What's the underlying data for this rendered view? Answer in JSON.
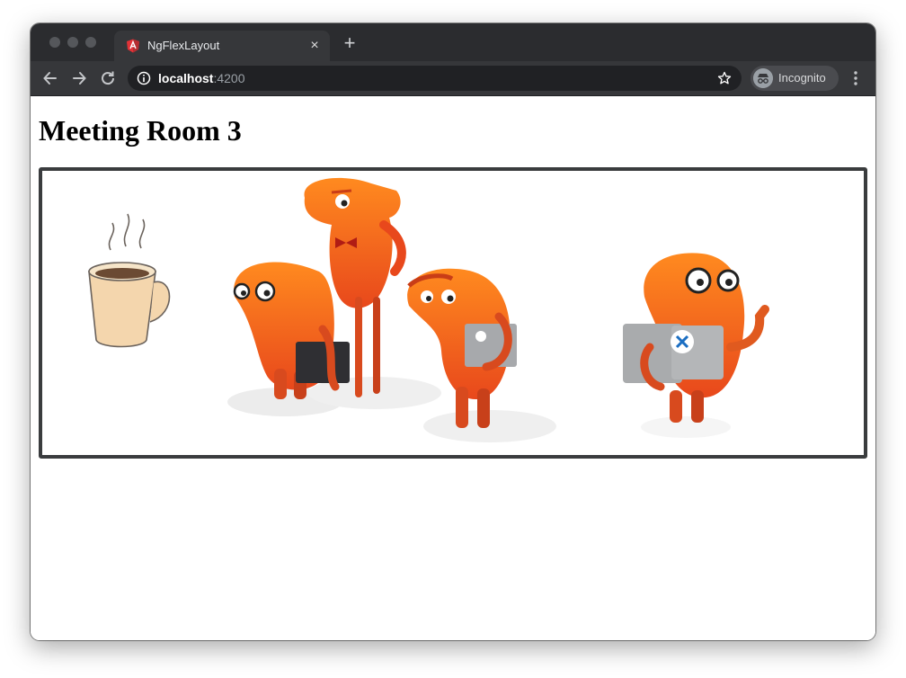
{
  "browser": {
    "tab": {
      "title": "NgFlexLayout",
      "favicon": "angular-shield-icon",
      "close_icon": "×"
    },
    "new_tab_icon": "+",
    "address": {
      "host": "localhost",
      "port": ":4200"
    },
    "incognito_label": "Incognito",
    "colors": {
      "titlebar": "#2b2c2f",
      "toolbar": "#36373a",
      "omnibox": "#202124"
    }
  },
  "page": {
    "title": "Meeting Room 3",
    "illustration": {
      "subjects": [
        "coffee-cup",
        "monster-with-glasses-and-laptop",
        "tall-monster-with-bowtie",
        "monster-with-laptop",
        "monster-thumbs-up"
      ],
      "accent_color": "#f26b1d"
    }
  }
}
